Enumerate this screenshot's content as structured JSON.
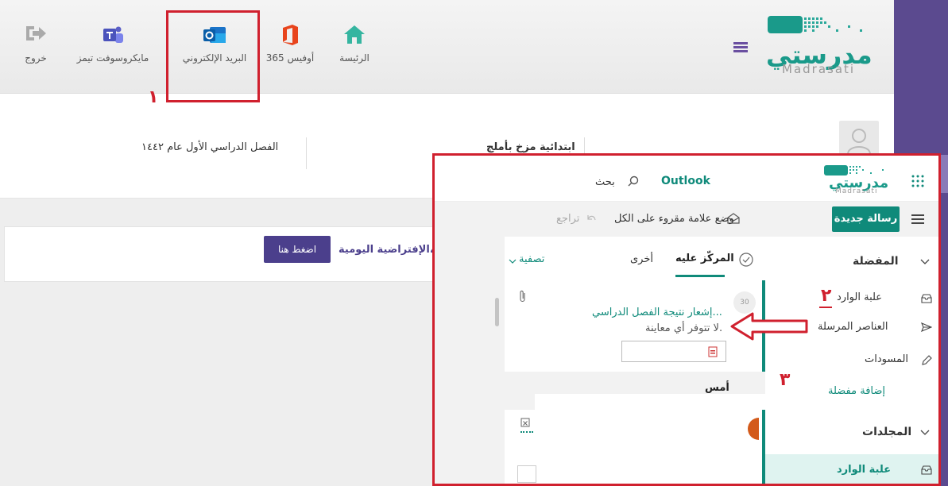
{
  "portal": {
    "logo_arabic": "مدرستي",
    "logo_latin": "Madrasati",
    "nav": {
      "home": "الرئيسة",
      "office365": "أوفيس 365",
      "email": "البريد الإلكتروني",
      "teams": "مايكروسوفت تيمز",
      "logout": "خروج"
    },
    "annotation_1": "١"
  },
  "profile": {
    "school": "ابتدائية مزخ بأملج",
    "term": "الفصل الدراسي الأول عام ١٤٤٢"
  },
  "banner": {
    "text": "الإفتراضية اليومية،",
    "button": "اضغط هنا"
  },
  "outlook": {
    "app_name": "Outlook",
    "search": "بحث",
    "logo_arabic": "مدرستي",
    "logo_latin": "Madrasati",
    "new_message": "رسالة جديدة",
    "mark_all_read": "وضع علامة مقروء على الكل",
    "undo": "تراجع",
    "sidebar": {
      "favorites": "المفضلة",
      "inbox": "علبة الوارد",
      "sent": "العناصر المرسلة",
      "drafts": "المسودات",
      "add_favorite": "إضافة مفضلة",
      "folders": "المجلدات",
      "inbox_folder": "علبة الوارد"
    },
    "tabs": {
      "focused": "المركّز عليه",
      "other": "أخرى",
      "filter": "تصفية"
    },
    "message": {
      "subject": "إشعار نتيجة الفصل الدراسي...",
      "preview": "لا تتوفر أي معاينة."
    },
    "group_yesterday": "أمس",
    "annotation_2": "٢",
    "annotation_3": "٣"
  }
}
